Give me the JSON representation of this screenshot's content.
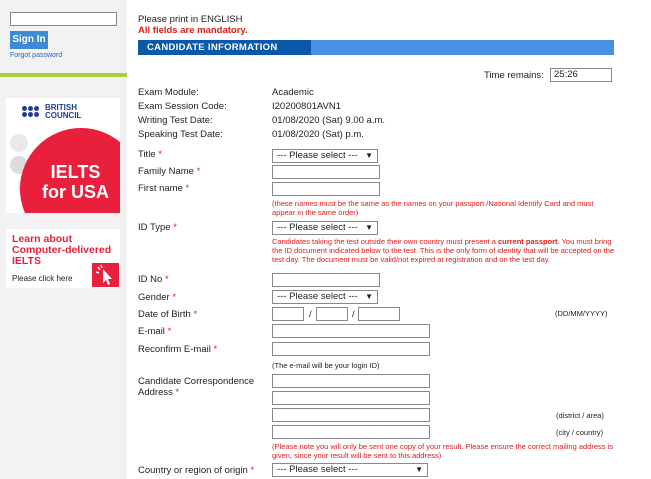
{
  "sidebar": {
    "signin_label": "Sign In",
    "forgot_label": "Forgot password",
    "ad": {
      "brand_line1": "BRITISH",
      "brand_line2": "COUNCIL",
      "title_line1": "IELTS",
      "title_line2": "for USA"
    },
    "cd": {
      "title": "Learn about Computer-delivered IELTS",
      "sub": "Please click here"
    }
  },
  "header": {
    "print_note": "Please print in ENGLISH",
    "mandatory_note": "All fields are mandatory.",
    "section_title": "CANDIDATE INFORMATION",
    "time_label": "Time remains:",
    "time_value": "25:26"
  },
  "info": {
    "module_label": "Exam Module:",
    "module_value": "Academic",
    "code_label": "Exam Session Code:",
    "code_value": "I20200801AVN1",
    "writing_label": "Writing Test Date:",
    "writing_value": "01/08/2020 (Sat) 9.00 a.m.",
    "speaking_label": "Speaking Test Date:",
    "speaking_value": "01/08/2020 (Sat) p.m."
  },
  "form": {
    "required_mark": "*",
    "title_label": "Title",
    "family_label": "Family Name",
    "first_label": "First name",
    "name_note": "(these names must be the same as the names on your passport /National Identify Card and must appear in the same order)",
    "idtype_label": "ID Type",
    "id_note_part1": "Candidates taking the test outside their own country must present a ",
    "id_note_bold": "current passport",
    "id_note_part2": ". You must bring the ID document indicated below to the test. This is the only form of identity that will be accepted on the test day. The document must be valid/not expired at registration and on the test day.",
    "idno_label": "ID No",
    "gender_label": "Gender",
    "dob_label": "Date of Birth",
    "dob_sep": "/",
    "dob_hint": "(DD/MM/YYYY)",
    "email_label": "E-mail",
    "reconfirm_label": "Reconfirm E-mail",
    "email_note": "(The e-mail will be your login ID)",
    "address_label_line1": "Candidate Correspondence",
    "address_label_line2": "Address",
    "district_hint": "(district / area)",
    "city_hint": "(city / country)",
    "address_note": "(Please note you will only be sent one copy of your result. Please ensure the correct mailing address is given, since your result will be sent to this address)",
    "country_label": "Country or region of origin",
    "select_placeholder": "--- Please select ---",
    "select_placeholder_short": "--- Please select ---"
  },
  "colors": {
    "accent": "#0a58a8",
    "required": "#e11a1a",
    "brand_red": "#e8203c",
    "green": "#a9cf3c"
  }
}
